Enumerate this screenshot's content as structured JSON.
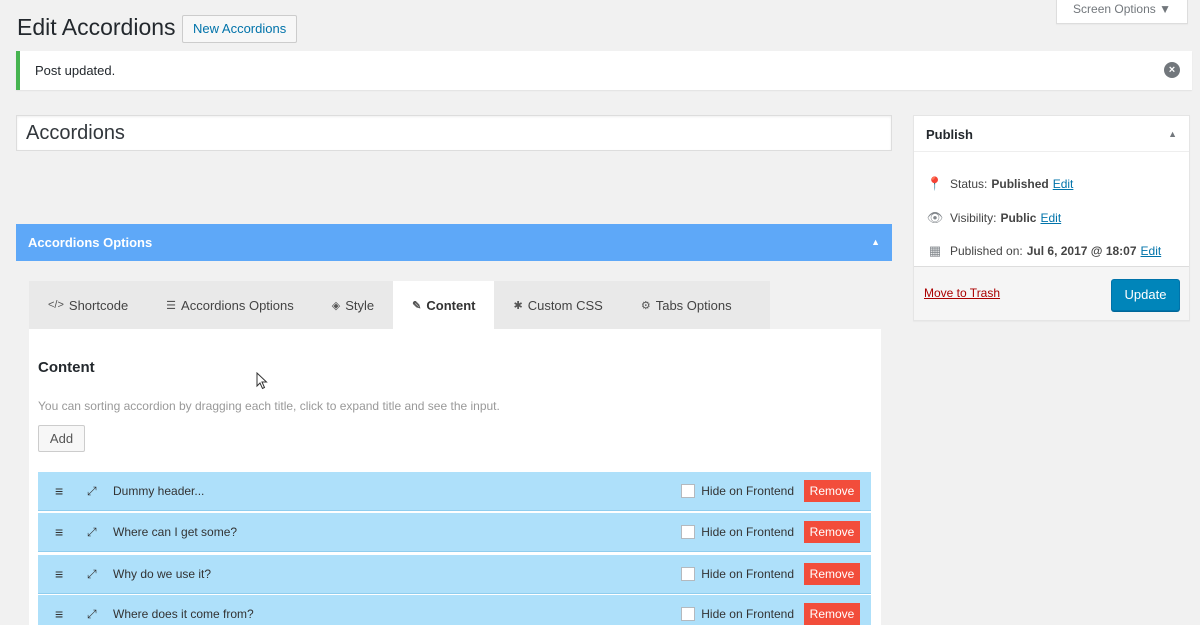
{
  "header": {
    "title": "Edit Accordions",
    "add_new_label": "New Accordions",
    "screen_options_label": "Screen Options ▼"
  },
  "notice": {
    "text": "Post updated.",
    "dismiss_icon": "close-circle-icon"
  },
  "post": {
    "title": "Accordions"
  },
  "publish": {
    "heading": "Publish",
    "status_label": "Status:",
    "status_value": "Published",
    "status_edit": "Edit",
    "visibility_label": "Visibility:",
    "visibility_value": "Public",
    "visibility_edit": "Edit",
    "published_label": "Published on:",
    "published_value": "Jul 6, 2017 @ 18:07",
    "published_edit": "Edit",
    "trash_label": "Move to Trash",
    "update_label": "Update"
  },
  "options_panel": {
    "title": "Accordions Options",
    "tabs": [
      {
        "label": "Shortcode",
        "icon": "</>"
      },
      {
        "label": "Accordions Options",
        "icon": "☰"
      },
      {
        "label": "Style",
        "icon": "◈"
      },
      {
        "label": "Content",
        "icon": "✎"
      },
      {
        "label": "Custom CSS",
        "icon": "✱"
      },
      {
        "label": "Tabs Options",
        "icon": "⚙"
      }
    ],
    "active_tab": "Content"
  },
  "content": {
    "heading": "Content",
    "description": "You can sorting accordion by dragging each title, click to expand title and see the input.",
    "add_label": "Add",
    "hide_label": "Hide on Frontend",
    "remove_label": "Remove",
    "items": [
      {
        "title": "Dummy header..."
      },
      {
        "title": "Where can I get some?"
      },
      {
        "title": "Why do we use it?"
      },
      {
        "title": "Where does it come from?"
      }
    ]
  },
  "colors": {
    "accent": "#5ea8f8",
    "row_bg": "#aee0fa",
    "remove_bg": "#f24d3b",
    "update_bg": "#0085ba",
    "notice_border": "#46b450"
  }
}
